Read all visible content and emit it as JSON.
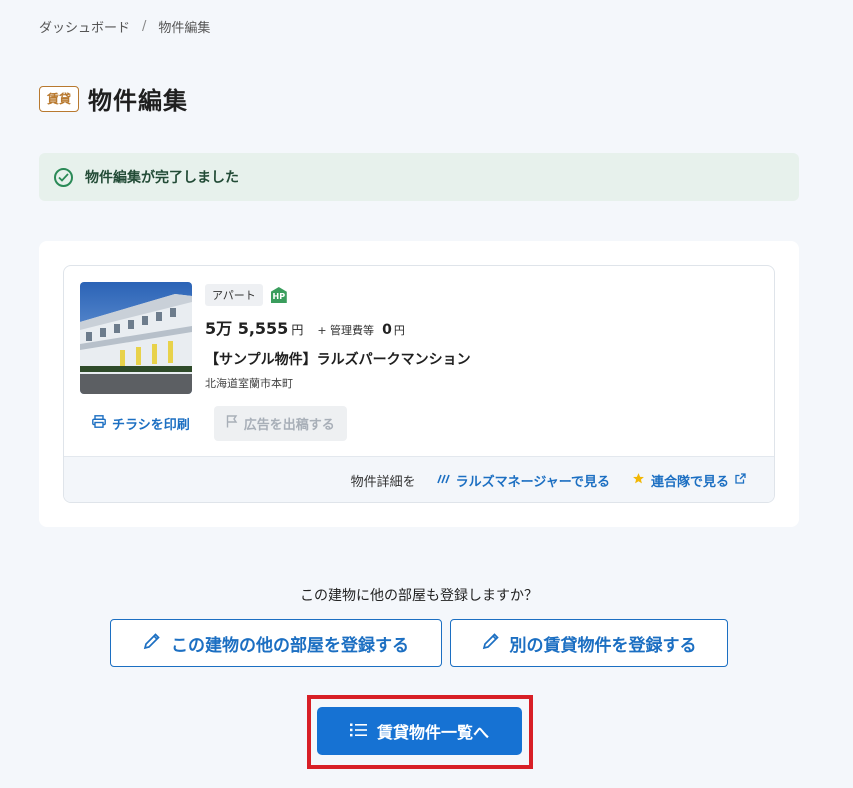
{
  "breadcrumb": {
    "home": "ダッシュボード",
    "separator": "/",
    "current": "物件編集"
  },
  "header": {
    "badge": "賃貸",
    "title": "物件編集"
  },
  "alert": {
    "message": "物件編集が完了しました",
    "color": "#2b8a57"
  },
  "property": {
    "type": "アパート",
    "hp_label": "HP",
    "rent": "5万 5,555",
    "rent_unit": "円",
    "fee_label": "+ 管理費等",
    "fee_value": "0",
    "fee_unit": "円",
    "name": "【サンプル物件】ラルズパークマンション",
    "address": "北海道室蘭市本町",
    "thumbnail_icon": "apartment-photo"
  },
  "actions": {
    "print": "チラシを印刷",
    "ad": "広告を出稿する"
  },
  "details": {
    "label": "物件詳細を",
    "manager_link": "ラルズマネージャーで見る",
    "rengotai_link": "連合隊で見る"
  },
  "next": {
    "question": "この建物に他の部屋も登録しますか？",
    "same_building": "この建物の他の部屋を登録する",
    "another_property": "別の賃貸物件を登録する",
    "list": "賃貸物件一覧へ"
  },
  "colors": {
    "primary": "#1672d3",
    "link": "#1c6fc2",
    "highlight": "#d81f26",
    "badge": "#b8792f"
  }
}
